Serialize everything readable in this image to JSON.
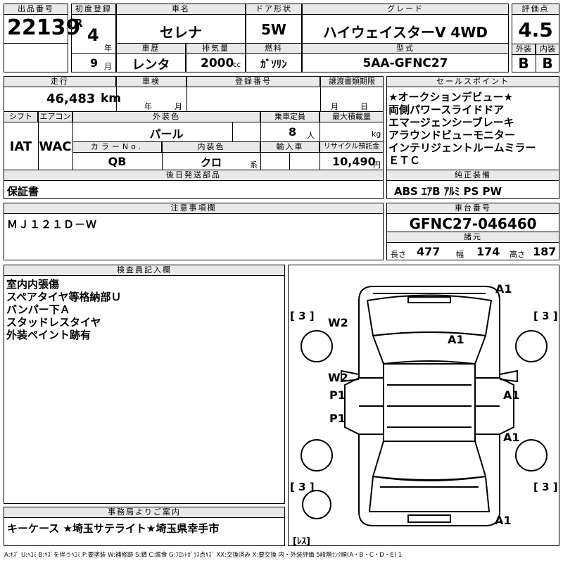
{
  "header": {
    "lot_no_label": "出品番号",
    "lot_no": "22139",
    "first_reg_label": "初度登録",
    "era": "R",
    "year": "4",
    "year_unit": "年",
    "month": "9",
    "month_unit": "月",
    "car_name_label": "車名",
    "car_name": "セレナ",
    "door_label": "ドア形状",
    "door": "5W",
    "grade_label": "グレード",
    "grade": "ハイウェイスターV 4WD",
    "score_label": "評価点",
    "score": "4.5",
    "history_label": "車歴",
    "history": "レンタ",
    "displacement_label": "排気量",
    "displacement": "2000",
    "displacement_unit": "cc",
    "fuel_label": "燃料",
    "fuel": "ｶﾞｿﾘﾝ",
    "model_label": "型式",
    "model": "5AA-GFNC27",
    "ext_label": "外装",
    "ext": "B",
    "int_label": "内装",
    "int": "B"
  },
  "row2": {
    "mileage_label": "走行",
    "mileage": "46,483",
    "mileage_unit": "km",
    "shaken_label": "車検",
    "shaken_year_unit": "年",
    "shaken_month_unit": "月",
    "reg_no_label": "登録番号",
    "transfer_label": "譲渡書類期限",
    "transfer_month_unit": "月",
    "transfer_day_unit": "日",
    "shift_label": "シフト",
    "shift": "IAT",
    "aircon_label": "エアコン",
    "aircon": "WAC",
    "ext_color_label": "外装色",
    "ext_color": "パール",
    "capacity_label": "乗車定員",
    "capacity": "8",
    "capacity_unit": "人",
    "max_load_label": "最大積載量",
    "max_load_unit": "kg",
    "color_no_label": "カラーNo.",
    "color_no": "QB",
    "int_color_label": "内装色",
    "int_color": "クロ",
    "int_color_unit": "系",
    "import_label": "輸入車",
    "recycle_label": "リサイクル預託金",
    "recycle": "10,490",
    "recycle_unit": "円"
  },
  "sales_points": {
    "label": "セールスポイント",
    "items": [
      "★オークションデビュー★",
      "両側パワースライドドア",
      "エマージェンシーブレーキ",
      "アラウンドビューモニター",
      "インテリジェントルームミラー",
      "ＥＴＣ"
    ]
  },
  "later_parts": {
    "label": "後日発送部品",
    "value": "保証書"
  },
  "genuine_equipment": {
    "label": "純正装備",
    "value": "ABS ｴｱB ｱﾙﾐ PS PW"
  },
  "notes": {
    "label": "注意事項欄",
    "value": "ＭＪ１２１Ｄ－Ｗ"
  },
  "chassis": {
    "label": "車台番号",
    "value": "GFNC27-046460"
  },
  "specs": {
    "label": "諸元",
    "length_label": "長さ",
    "length": "477",
    "width_label": "幅",
    "width": "174",
    "height_label": "高さ",
    "height": "187"
  },
  "inspector": {
    "label": "検査員記入欄",
    "lines": [
      "室内内張傷",
      "スペアタイヤ等格納部Ｕ",
      "バンパー下Ａ",
      "スタッドレスタイヤ",
      "外装ペイント跡有"
    ]
  },
  "diagram": {
    "marks": {
      "a1_top": "A1",
      "a1_roof": "A1",
      "w2_left": "W2",
      "w2_mid": "W2",
      "p1_a": "P1",
      "p1_b": "P1",
      "a1_right_a": "A1",
      "a1_right_b": "A1",
      "a1_bottom": "A1",
      "tire_tl": "[ 3 ]",
      "tire_tr": "[ 3 ]",
      "tire_bl": "[ 3 ]",
      "tire_br": "[ 3 ]",
      "spare": "[ﾚｽ]"
    }
  },
  "office": {
    "label": "事務局よりご案内",
    "value": "キーケース ★埼玉サテライト★埼玉県幸手市"
  },
  "footer": "A:ｷｽﾞ U:ﾍｺﾐ B:ｷｽﾞを伴うﾍｺﾐ P:要塗装 W:補修跡 S:錆 C:腐食 G:ﾌﾛﾝﾄｶﾞﾗｽ点ｷｽﾞ XX:交換済み X:要交換 内・外装評価 5段階ﾗﾝｸ順(A・B・C・D・E) 1"
}
